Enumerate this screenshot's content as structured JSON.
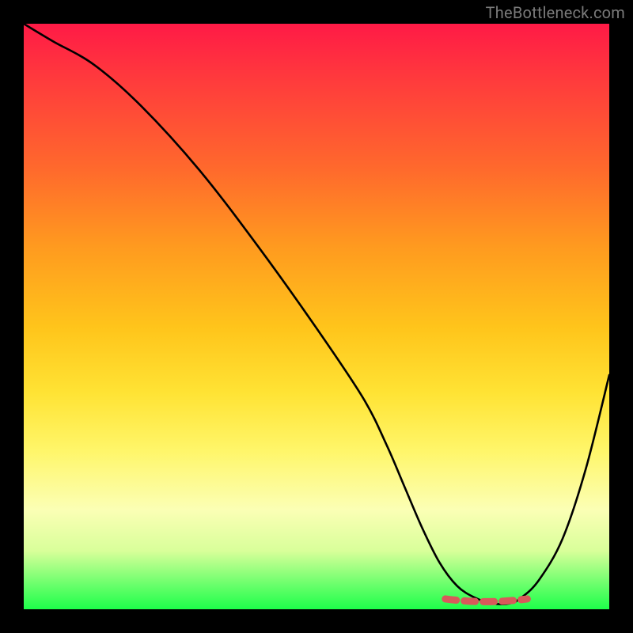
{
  "attribution": "TheBottleneck.com",
  "colors": {
    "gradient_top": "#ff1a46",
    "gradient_mid": "#ffe334",
    "gradient_bottom": "#1eff4a",
    "curve": "#000000",
    "accent": "#d85a5a",
    "background": "#000000"
  },
  "chart_data": {
    "type": "line",
    "title": "",
    "xlabel": "",
    "ylabel": "",
    "xlim": [
      0,
      100
    ],
    "ylim": [
      0,
      100
    ],
    "grid": false,
    "legend": false,
    "series": [
      {
        "name": "bottleneck-curve",
        "x": [
          0,
          5,
          12,
          20,
          30,
          40,
          50,
          58,
          62,
          65,
          68,
          71,
          74,
          77,
          80,
          83,
          85,
          88,
          92,
          96,
          100
        ],
        "y": [
          100,
          97,
          93,
          86,
          75,
          62,
          48,
          36,
          28,
          21,
          14,
          8,
          4,
          2,
          1,
          1,
          2,
          5,
          12,
          24,
          40
        ]
      }
    ],
    "annotations": [
      {
        "name": "flat-bottom-highlight",
        "x_start": 72,
        "x_end": 86,
        "y": 1.5
      }
    ]
  }
}
